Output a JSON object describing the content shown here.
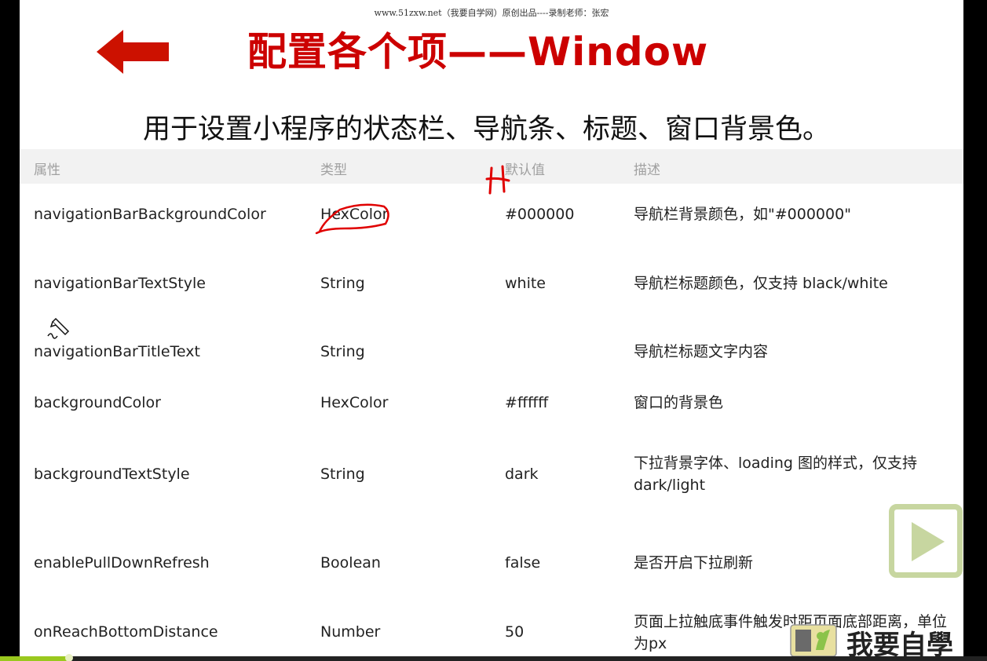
{
  "watermark": "www.51zxw.net（我要自学网）原创出品----录制老师：张宏",
  "slide": {
    "title": "配置各个项——Window",
    "subtitle": "用于设置小程序的状态栏、导航条、标题、窗口背景色。"
  },
  "table": {
    "headers": [
      "属性",
      "类型",
      "默认值",
      "描述"
    ],
    "rows": [
      {
        "prop": "navigationBarBackgroundColor",
        "type": "HexColor",
        "default": "#000000",
        "desc": "导航栏背景颜色，如\"#000000\""
      },
      {
        "prop": "navigationBarTextStyle",
        "type": "String",
        "default": "white",
        "desc": "导航栏标题颜色，仅支持 black/white"
      },
      {
        "prop": "navigationBarTitleText",
        "type": "String",
        "default": "",
        "desc": "导航栏标题文字内容"
      },
      {
        "prop": "backgroundColor",
        "type": "HexColor",
        "default": "#ffffff",
        "desc": "窗口的背景色"
      },
      {
        "prop": "backgroundTextStyle",
        "type": "String",
        "default": "dark",
        "desc": "下拉背景字体、loading 图的样式，仅支持 dark/light"
      },
      {
        "prop": "enablePullDownRefresh",
        "type": "Boolean",
        "default": "false",
        "desc": "是否开启下拉刷新"
      },
      {
        "prop": "onReachBottomDistance",
        "type": "Number",
        "default": "50",
        "desc": "页面上拉触底事件触发时距页面底部距离，单位为px"
      }
    ]
  },
  "logo": {
    "text": "我要自學"
  },
  "player": {
    "progress": 0.07
  },
  "icons": {
    "back": "back-arrow-icon",
    "play": "play-icon",
    "pencil": "pencil-cursor-icon",
    "logo": "logo-icon"
  },
  "colors": {
    "title": "#cc0000",
    "header_bg": "#f2f2f2",
    "annotation": "#e00000",
    "play_border": "#c7d6a0",
    "progress": "#9ac81e"
  }
}
